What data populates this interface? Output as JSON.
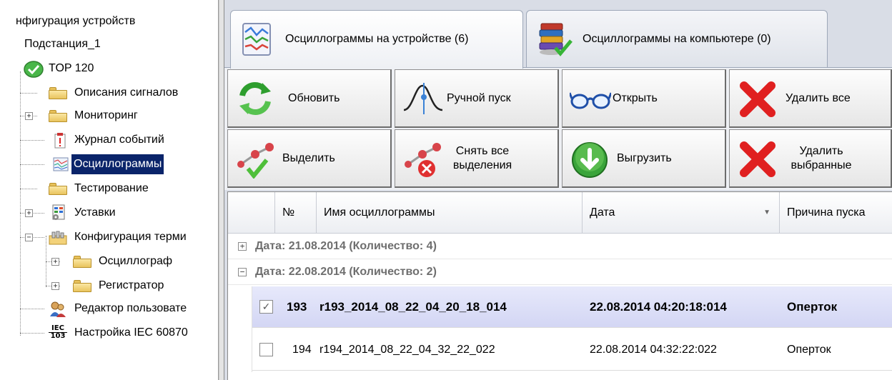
{
  "tree": {
    "root_label": "нфигурация устройств",
    "substation": "Подстанция_1",
    "device": "TOP 120",
    "items": [
      {
        "label": "Описания сигналов"
      },
      {
        "label": "Мониторинг"
      },
      {
        "label": "Журнал событий"
      },
      {
        "label": "Осциллограммы"
      },
      {
        "label": "Тестирование"
      },
      {
        "label": "Уставки"
      },
      {
        "label": "Конфигурация терми"
      },
      {
        "label": "Осциллограф"
      },
      {
        "label": "Регистратор"
      },
      {
        "label": "Редактор пользовате"
      },
      {
        "label": "Настройка IEC 60870"
      }
    ],
    "iec_icon_text": [
      "IEC",
      "103"
    ],
    "selected": "Осциллограммы"
  },
  "tabs": [
    {
      "label": "Осциллограммы на устройстве (6)",
      "active": true
    },
    {
      "label": "Осциллограммы на компьютере (0)",
      "active": false
    }
  ],
  "toolbar": {
    "refresh": "Обновить",
    "manual_start": "Ручной пуск",
    "open": "Открыть",
    "delete_all": "Удалить все",
    "select": "Выделить",
    "deselect_all_1": "Снять все",
    "deselect_all_2": "выделения",
    "upload": "Выгрузить",
    "delete_selected_1": "Удалить",
    "delete_selected_2": "выбранные"
  },
  "grid": {
    "columns": [
      "№",
      "Имя осциллограммы",
      "Дата",
      "Причина пуска"
    ],
    "sort_indicator": "▼",
    "groups": [
      {
        "label": "Дата: 21.08.2014 (Количество: 4)",
        "expander": "+"
      },
      {
        "label": "Дата: 22.08.2014 (Количество: 2)",
        "expander": "−"
      }
    ],
    "rows": [
      {
        "checked": "✓",
        "num": "193",
        "name": "r193_2014_08_22_04_20_18_014",
        "date": "22.08.2014 04:20:18:014",
        "reason": "Оперток"
      },
      {
        "checked": "",
        "num": "194",
        "name": "r194_2014_08_22_04_32_22_022",
        "date": "22.08.2014 04:32:22:022",
        "reason": "Оперток"
      }
    ]
  },
  "colors": {
    "selection": "#0a246a",
    "selected_row": "#d3d6f4",
    "delete_red": "#e02020",
    "refresh_green": "#3aa43a"
  }
}
